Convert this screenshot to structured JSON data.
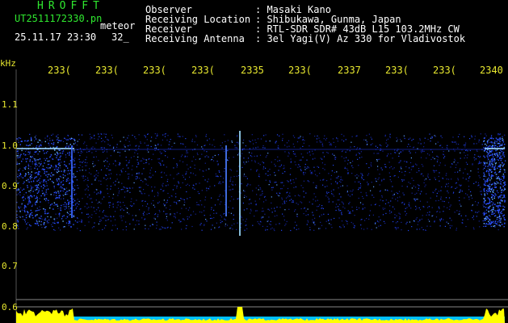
{
  "header": {
    "brand": "HROFFT",
    "filename": "UT2511172330.pn",
    "tag": "meteor",
    "timestamp": "25.11.17 23:30",
    "counter": "32_",
    "fields": [
      {
        "label": "Observer",
        "value": ": Masaki Kano"
      },
      {
        "label": "Receiving Location",
        "value": ": Shibukawa, Gunma, Japan"
      },
      {
        "label": "Receiver",
        "value": ": RTL-SDR SDR# 43dB L15 103.2MHz CW"
      },
      {
        "label": "Receiving Antenna",
        "value": ": 3el Yagi(V) Az 330 for Vladivostok"
      }
    ]
  },
  "axis": {
    "y_unit": "kHz",
    "y_ticks": [
      "1.1",
      "1.0",
      "0.9",
      "0.8",
      "0.7",
      "0.6"
    ],
    "x_ticks": [
      "233(",
      "233(",
      "233(",
      "233(",
      "2335",
      "233(",
      "2337",
      "233(",
      "233(",
      "2340"
    ]
  },
  "colors": {
    "background": "#000000",
    "header_text": "#ffffff",
    "brand": "#2fe82f",
    "axis_label": "#e8e82f",
    "signal": "#1e3cff",
    "carrier": "#9fd8ff",
    "power_trace": "#ffff00",
    "noise_floor": "#00c0ff"
  }
}
